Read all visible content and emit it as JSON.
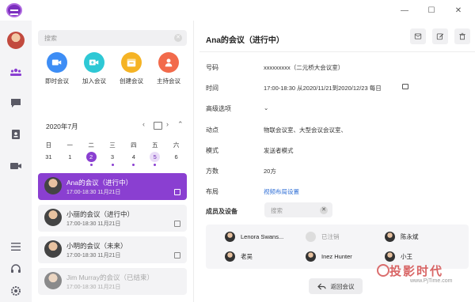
{
  "window": {
    "minimize": "—",
    "restore": "☐",
    "close": "✕"
  },
  "search": {
    "placeholder": "搜索"
  },
  "quick_actions": [
    {
      "label": "即时会议",
      "color": "#3d8df5"
    },
    {
      "label": "加入会议",
      "color": "#2ec8d5"
    },
    {
      "label": "创建会议",
      "color": "#f5b324"
    },
    {
      "label": "主持会议",
      "color": "#f26a4b"
    }
  ],
  "calendar": {
    "month_label": "2020年7月",
    "weekdays": [
      "日",
      "一",
      "二",
      "三",
      "四",
      "五",
      "六"
    ],
    "days": [
      "31",
      "1",
      "2",
      "3",
      "4",
      "5",
      "6"
    ],
    "selected_day": "2",
    "event_days": [
      "2",
      "3",
      "4",
      "5"
    ]
  },
  "meetings": [
    {
      "title": "Ana的会议（进行中）",
      "time": "17:00-18:30   11月21日",
      "state": "active"
    },
    {
      "title": "小丽的会议（进行中）",
      "time": "17:00-18:30   11月21日",
      "state": "normal"
    },
    {
      "title": "小明的会议（未来）",
      "time": "17:00-18:30   11月21日",
      "state": "normal"
    },
    {
      "title": "Jim Murray的会议（已结束）",
      "time": "17:00-18:30   11月21日",
      "state": "ended"
    }
  ],
  "detail": {
    "title": "Ana的会议（进行中）",
    "fields": [
      {
        "key": "号码",
        "value": "xxxxxxxxx（二元桥大会议室）"
      },
      {
        "key": "时间",
        "value": "17:00-18:30   从2020/11/21到2020/12/23   每日"
      },
      {
        "key": "高级选项",
        "value": "⌄"
      },
      {
        "key": "动点",
        "value": "物联会议室、大型会议会议室、"
      },
      {
        "key": "模式",
        "value": "发送者模式"
      },
      {
        "key": "方数",
        "value": "20方"
      },
      {
        "key": "布局",
        "value": "视频布局设置"
      }
    ],
    "members_label": "成员及设备",
    "members_search_placeholder": "搜索",
    "members": [
      {
        "name": "Lenora Swans...",
        "state": "normal"
      },
      {
        "name": "已注销",
        "state": "inactive"
      },
      {
        "name": "陈永斌",
        "state": "normal"
      },
      {
        "name": "老吴",
        "state": "normal"
      },
      {
        "name": "Inez Hunter",
        "state": "normal"
      },
      {
        "name": "小王",
        "state": "normal"
      }
    ],
    "back_button": "返回会议"
  },
  "watermark": {
    "text": "投影时代",
    "url": "www.PjTime.com"
  },
  "colors": {
    "accent": "#8a3fd1",
    "link": "#2f6fd6"
  }
}
